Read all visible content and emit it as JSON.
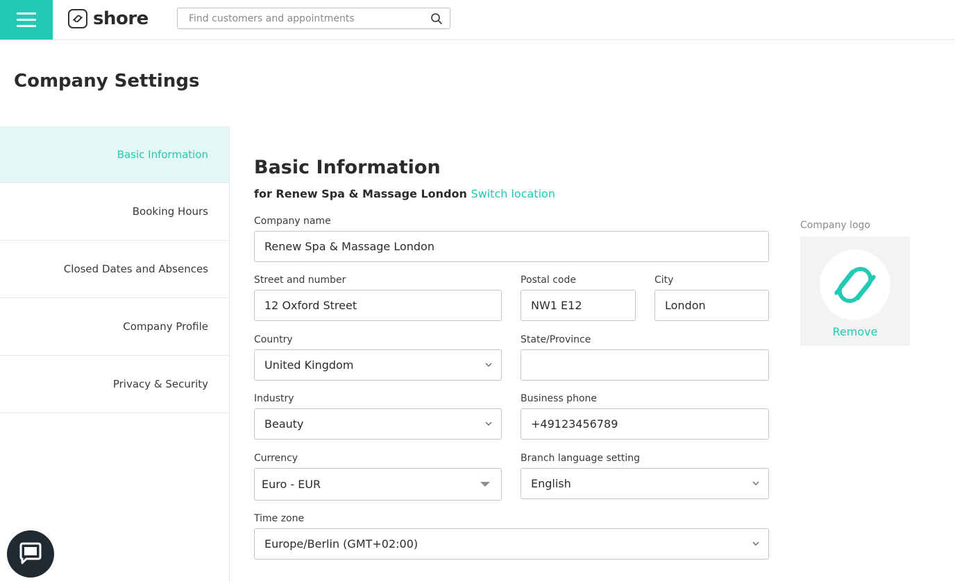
{
  "topbar": {
    "brand": "shore",
    "search_placeholder": "Find customers and appointments"
  },
  "header": {
    "title": "Company Settings"
  },
  "sidebar": {
    "items": [
      {
        "label": "Basic Information",
        "active": true
      },
      {
        "label": "Booking Hours",
        "active": false
      },
      {
        "label": "Closed Dates and Absences",
        "active": false
      },
      {
        "label": "Company Profile",
        "active": false
      },
      {
        "label": "Privacy & Security",
        "active": false
      }
    ]
  },
  "main": {
    "title": "Basic Information",
    "subtitle_prefix": "for Renew Spa & Massage London",
    "switch_location": "Switch location",
    "fields": {
      "company_name": {
        "label": "Company name",
        "value": "Renew Spa & Massage London"
      },
      "street": {
        "label": "Street and number",
        "value": "12 Oxford Street"
      },
      "postal_code": {
        "label": "Postal code",
        "value": "NW1 E12"
      },
      "city": {
        "label": "City",
        "value": "London"
      },
      "country": {
        "label": "Country",
        "value": "United Kingdom"
      },
      "state": {
        "label": "State/Province",
        "value": ""
      },
      "industry": {
        "label": "Industry",
        "value": "Beauty"
      },
      "business_phone": {
        "label": "Business phone",
        "value": "+49123456789"
      },
      "currency": {
        "label": "Currency",
        "value": "Euro - EUR"
      },
      "branch_language": {
        "label": "Branch language setting",
        "value": "English"
      },
      "time_zone": {
        "label": "Time zone",
        "value": "Europe/Berlin (GMT+02:00)"
      }
    },
    "logo": {
      "label": "Company logo",
      "remove": "Remove"
    }
  },
  "colors": {
    "accent": "#22c9b4",
    "active_bg": "#e4f7f5",
    "chat_bg": "#1f2a33"
  },
  "icons": {
    "menu": "hamburger-icon",
    "search": "search-icon",
    "dropdown": "chevron-down-icon",
    "chat": "chat-icon"
  }
}
